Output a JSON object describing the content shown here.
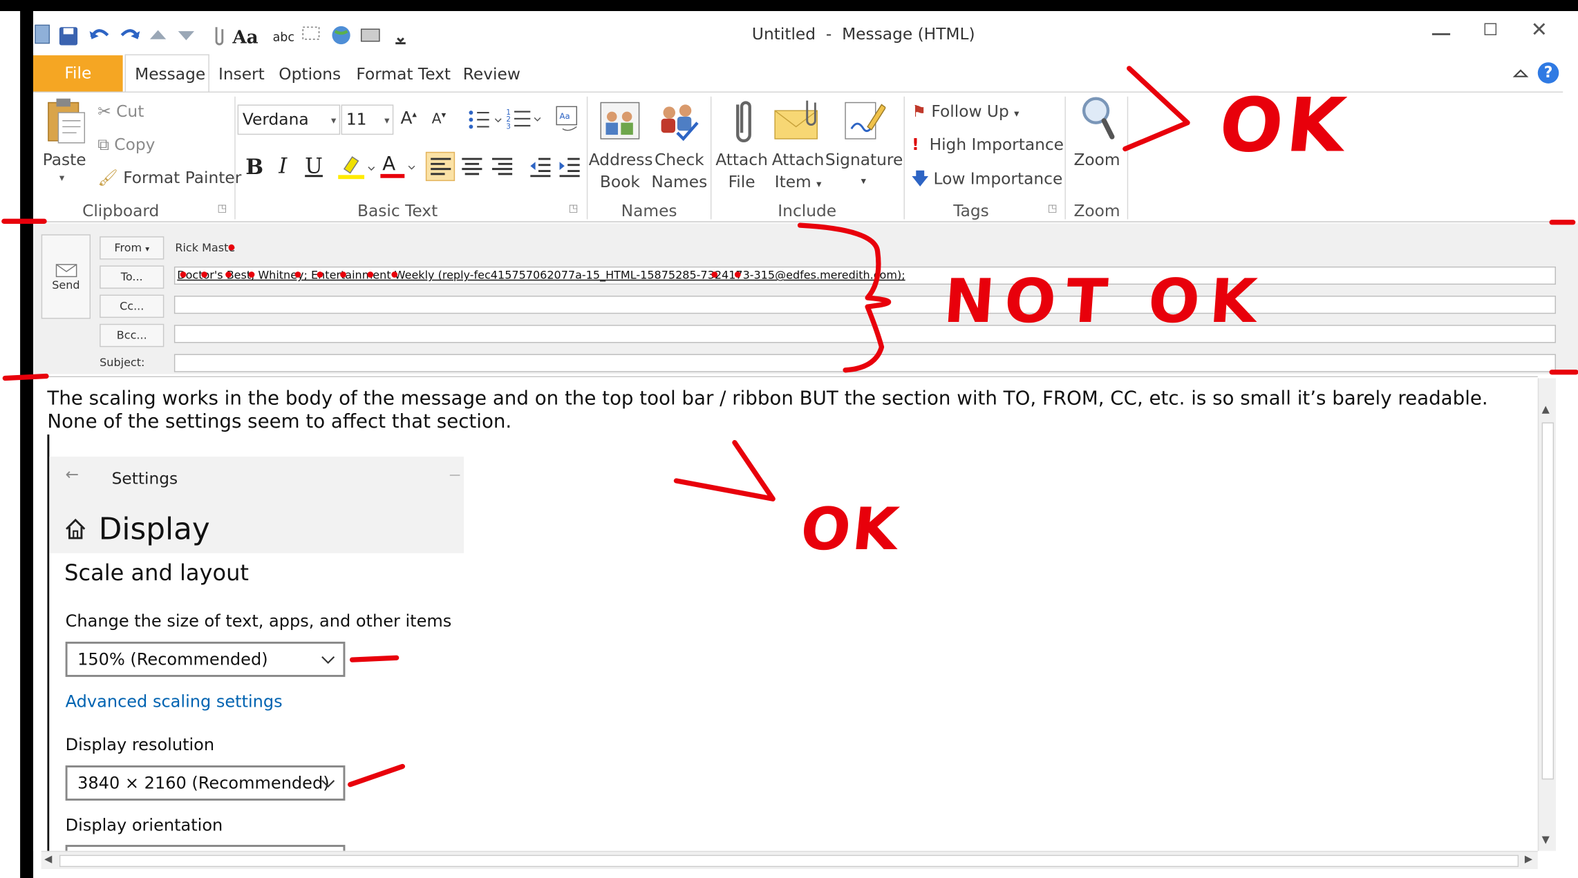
{
  "window": {
    "title": "Untitled  -  Message (HTML)"
  },
  "tabs": {
    "file": "File",
    "message": "Message",
    "insert": "Insert",
    "options": "Options",
    "format_text": "Format Text",
    "review": "Review"
  },
  "clipboard": {
    "paste": "Paste",
    "cut": "Cut",
    "copy": "Copy",
    "format_painter": "Format Painter",
    "group": "Clipboard"
  },
  "basic_text": {
    "font": "Verdana",
    "size": "11",
    "group": "Basic Text",
    "bold": "B",
    "italic": "I",
    "underline": "U"
  },
  "names": {
    "address_1": "Address",
    "address_2": "Book",
    "check_1": "Check",
    "check_2": "Names",
    "group": "Names"
  },
  "include": {
    "attach_file_1": "Attach",
    "attach_file_2": "File",
    "attach_item_1": "Attach",
    "attach_item_2": "Item",
    "signature": "Signature",
    "group": "Include"
  },
  "tags": {
    "follow_up": "Follow Up",
    "high": "High Importance",
    "low": "Low Importance",
    "group": "Tags"
  },
  "zoom": {
    "label": "Zoom",
    "group": "Zoom"
  },
  "header": {
    "send": "Send",
    "from_btn": "From",
    "from_value": "Rick Maste",
    "to_btn": "To...",
    "to_value": "Doctor's Best, Whitney; Entertainment Weekly (reply-fec415757062077a-15_HTML-15875285-7324173-315@edfes.meredith.com);",
    "cc_btn": "Cc...",
    "bcc_btn": "Bcc...",
    "subject": "Subject:"
  },
  "body": {
    "text": "The scaling works in the body of the message and on the top tool bar / ribbon BUT the section with TO, FROM, CC, etc. is so small it’s barely readable. None of the settings seem to affect that section."
  },
  "settings": {
    "title": "Settings",
    "heading": "Display",
    "section": "Scale and layout",
    "scale_label": "Change the size of text, apps, and other items",
    "scale_value": "150% (Recommended)",
    "advanced": "Advanced scaling settings",
    "resolution_label": "Display resolution",
    "resolution_value": "3840 × 2160 (Recommended)",
    "orientation_label": "Display orientation"
  },
  "annotations": {
    "ok_1": "OK",
    "not_ok": "NOT OK",
    "ok_2": "OK"
  },
  "colors": {
    "file_tab": "#f5a623",
    "annotation": "#e8000b",
    "link": "#0063b1",
    "ribbon": "#ffffff",
    "header_bg": "#f0f0f0"
  }
}
